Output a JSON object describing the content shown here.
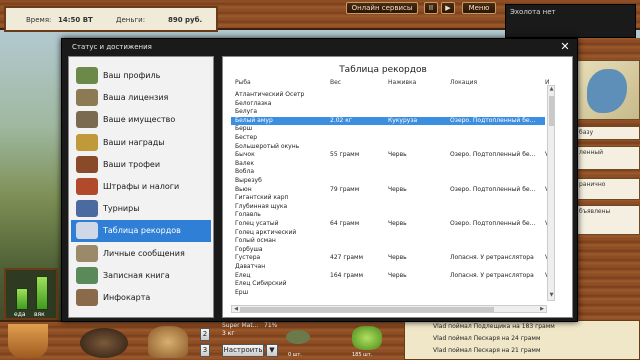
{
  "topbar": {
    "time_label": "Время:",
    "time_value": "14:50 ВТ",
    "money_label": "Деньги:",
    "money_value": "890 руб.",
    "online_services": "Онлайн сервисы",
    "pause_label": "II",
    "play_label": "▶",
    "menu_label": "Меню"
  },
  "sonar": {
    "label": "Эхолота нет"
  },
  "right_panel": {
    "cards": [
      "базу",
      "ленный",
      "ранично",
      "бъявлены"
    ]
  },
  "dialog": {
    "title": "Статус и достижения",
    "close_icon": "close-icon",
    "menu": [
      {
        "label": "Ваш профиль",
        "icon": "profile-icon",
        "color": "#6b8a4a"
      },
      {
        "label": "Ваша лицензия",
        "icon": "license-icon",
        "color": "#8c7a55"
      },
      {
        "label": "Ваше имущество",
        "icon": "property-icon",
        "color": "#7a6a50"
      },
      {
        "label": "Ваши награды",
        "icon": "trophy-cup-icon",
        "color": "#c09a3a"
      },
      {
        "label": "Ваши трофеи",
        "icon": "fish-trophy-icon",
        "color": "#8a4a2a"
      },
      {
        "label": "Штрафы и налоги",
        "icon": "fines-icon",
        "color": "#b04a2a"
      },
      {
        "label": "Турниры",
        "icon": "tournament-icon",
        "color": "#4a6aa0"
      },
      {
        "label": "Таблица рекордов",
        "icon": "records-chart-icon",
        "color": "#d0d8e8",
        "active": true
      },
      {
        "label": "Личные сообщения",
        "icon": "messages-icon",
        "color": "#9a8a6a"
      },
      {
        "label": "Записная книга",
        "icon": "notebook-icon",
        "color": "#5a8a5a"
      },
      {
        "label": "Инфокарта",
        "icon": "infocard-icon",
        "color": "#8a6a4a"
      }
    ]
  },
  "records": {
    "title": "Таблица рекордов",
    "columns": [
      "Рыба",
      "Вес",
      "Наживка",
      "Локация",
      "И"
    ],
    "rows": [
      [
        "Атлантический Осетр",
        "",
        "",
        "",
        ""
      ],
      [
        "Белоглазка",
        "",
        "",
        "",
        ""
      ],
      [
        "Белуга",
        "",
        "",
        "",
        ""
      ],
      [
        "Белый амур",
        "2.02 кг",
        "Кукуруза",
        "Озеро. Подтопленный бе...",
        "V"
      ],
      [
        "Берш",
        "",
        "",
        "",
        ""
      ],
      [
        "Бестер",
        "",
        "",
        "",
        ""
      ],
      [
        "Большеротый окунь",
        "",
        "",
        "",
        ""
      ],
      [
        "Бычок",
        "55 грамм",
        "Червь",
        "Озеро. Подтопленный бе...",
        "V"
      ],
      [
        "Валек",
        "",
        "",
        "",
        ""
      ],
      [
        "Вобла",
        "",
        "",
        "",
        ""
      ],
      [
        "Вырезуб",
        "",
        "",
        "",
        ""
      ],
      [
        "Вьюн",
        "79 грамм",
        "Червь",
        "Озеро. Подтопленный бе...",
        "V"
      ],
      [
        "Гигантский карп",
        "",
        "",
        "",
        ""
      ],
      [
        "Глубинная щука",
        "",
        "",
        "",
        ""
      ],
      [
        "Голавль",
        "",
        "",
        "",
        ""
      ],
      [
        "Голец усатый",
        "64 грамм",
        "Червь",
        "Озеро. Подтопленный бе...",
        "V"
      ],
      [
        "Голец арктический",
        "",
        "",
        "",
        ""
      ],
      [
        "Голый осман",
        "",
        "",
        "",
        ""
      ],
      [
        "Горбуша",
        "",
        "",
        "",
        ""
      ],
      [
        "Густера",
        "427 грамм",
        "Червь",
        "Лопасня. У ретранслятора",
        "V"
      ],
      [
        "Даватчан",
        "",
        "",
        "",
        ""
      ],
      [
        "Елец",
        "164 грамм",
        "Червь",
        "Лопасня. У ретранслятора",
        "V"
      ],
      [
        "Елец Сибирский",
        "",
        "",
        "",
        ""
      ],
      [
        "Ерш",
        "",
        "",
        "",
        ""
      ]
    ],
    "selected_row": 3
  },
  "bottom": {
    "left_labels": [
      "еда",
      "вяк"
    ],
    "slot_counts": [
      "2",
      "3"
    ],
    "lure_name": "Super Mat...",
    "lure_weight": "3 кг",
    "lure_percent": "71%",
    "configure_label": "Настроить",
    "count_a": "0 шт.",
    "count_b": "185 шт.",
    "chat": [
      "Vlad поймал Подлещика на 183 грамм",
      "Vlad поймал Пескаря на 24 грамм",
      "Vlad поймал Пескаря на 21 грамм"
    ]
  }
}
